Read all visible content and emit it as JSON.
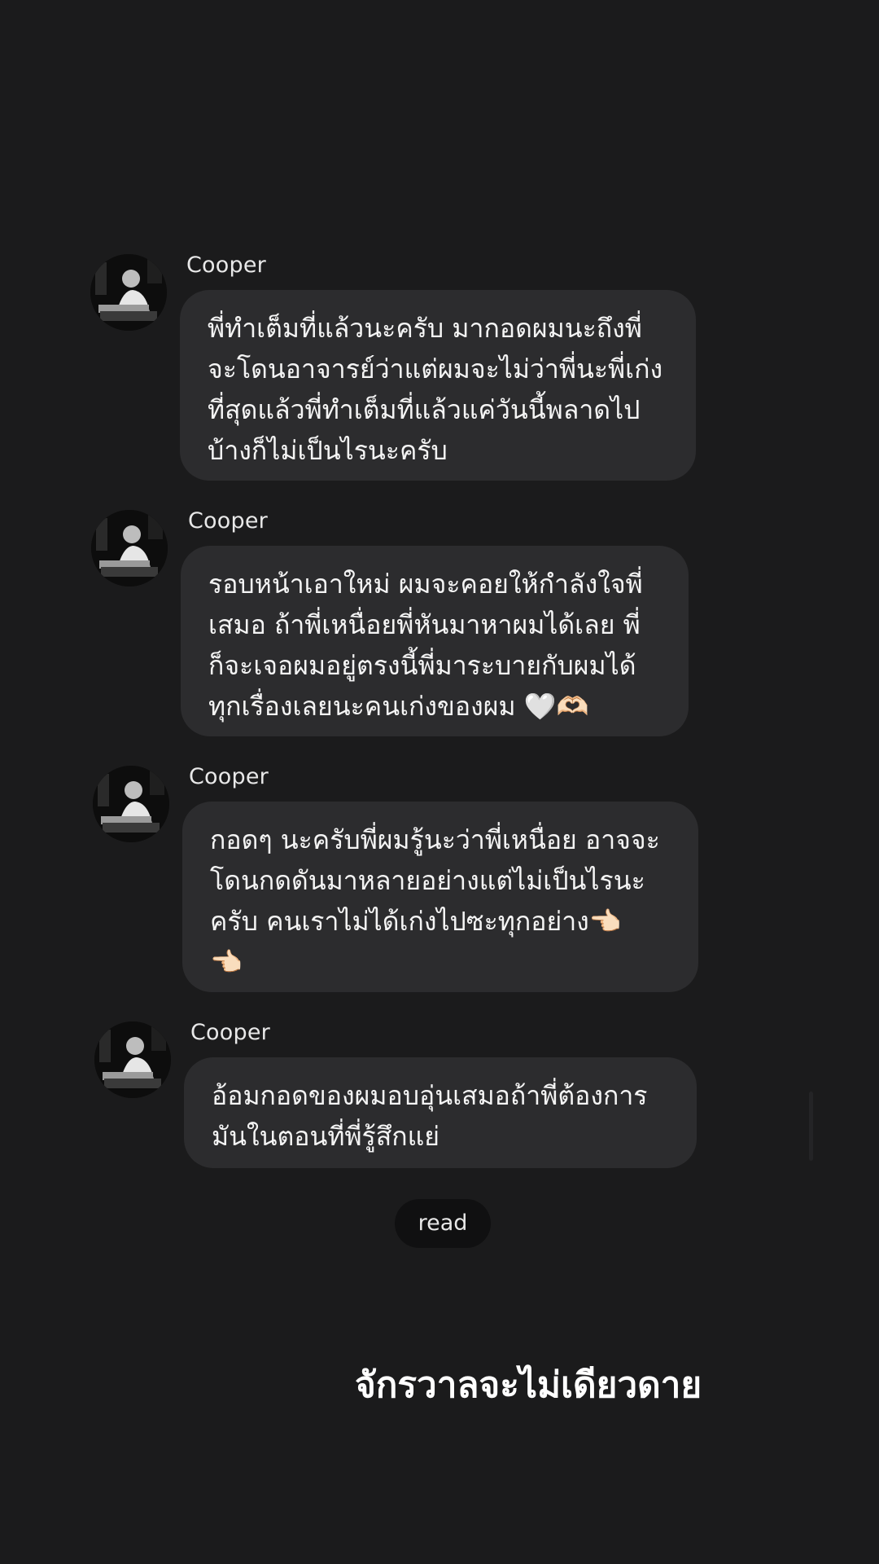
{
  "messages": [
    {
      "sender": "Cooper",
      "lines": [
        "พี่ทำเต็มที่แล้วนะครับ มากอดผมนะถึงพี่",
        "จะโดนอาจารย์ว่าแต่ผมจะไม่ว่าพี่นะพี่เก่ง",
        "ที่สุดแล้วพี่ทำเต็มที่แล้วแค่วันนี้พลาดไป",
        "บ้างก็ไม่เป็นไรนะครับ"
      ]
    },
    {
      "sender": "Cooper",
      "lines": [
        "รอบหน้าเอาใหม่ ผมจะคอยให้กำลังใจพี่",
        "เสมอ ถ้าพี่เหนื่อยพี่หันมาหาผมได้เลย พี่",
        "ก็จะเจอผมอยู่ตรงนี้พี่มาระบายกับผมได้",
        "ทุกเรื่องเลยนะคนเก่งของผม 🤍🫶🏻"
      ]
    },
    {
      "sender": "Cooper",
      "lines": [
        "กอดๆ นะครับพี่ผมรู้นะว่าพี่เหนื่อย อาจจะ",
        "โดนกดดันมาหลายอย่างแต่ไม่เป็นไรนะ",
        "ครับ คนเราไม่ได้เก่งไปซะทุกอย่าง👈🏻",
        "👈🏻"
      ]
    },
    {
      "sender": "Cooper",
      "lines": [
        "อ้อมกอดของผมอบอุ่นเสมอถ้าพี่ต้องการ",
        "มันในตอนที่พี่รู้สึกแย่"
      ]
    }
  ],
  "status": {
    "read_label": "read"
  },
  "caption": "จักรวาลจะไม่เดียวดาย"
}
